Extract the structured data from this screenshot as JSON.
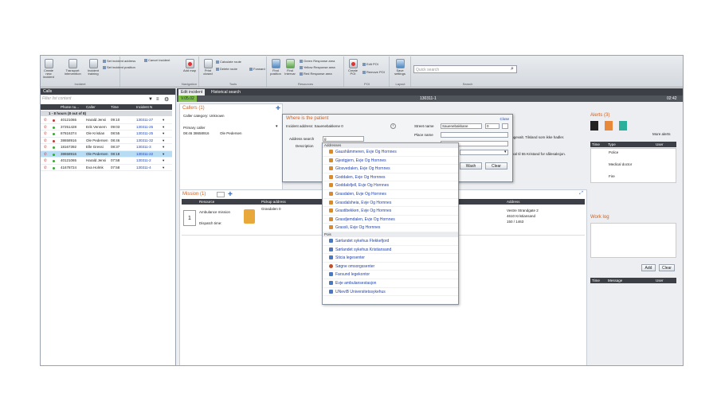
{
  "ribbon": {
    "groups": [
      {
        "label": "Incident",
        "buttons": [
          "Create new incident",
          "Transport intervention",
          "Incident training"
        ]
      },
      {
        "label": "Navigation",
        "buttons": [
          "Add map"
        ]
      },
      {
        "label": "Tools",
        "buttons": [
          "Print closed"
        ]
      },
      {
        "label": "Resources",
        "buttons": [
          "Find position",
          "Find Intervar"
        ]
      },
      {
        "label": "POI",
        "buttons": [
          "Create POI"
        ]
      },
      {
        "label": "Layout",
        "buttons": [
          "Save settings"
        ]
      },
      {
        "label": "Search",
        "buttons": []
      }
    ],
    "small": {
      "set_incident_address": "Set incident address",
      "cancel_incident": "Cancel incident",
      "set_incident_position": "Set incident position",
      "calculate_route": "Calculate route",
      "delete_route": "Delete route",
      "forward": "Forward",
      "green_response_area": "Green Response area",
      "yellow_response_area": "Yellow Response area",
      "red_response_area": "Red Response area",
      "edit_poi": "Edit POI",
      "remove_poi": "Remove POI"
    },
    "quick_search_placeholder": "Quick search"
  },
  "calls": {
    "title": "Calls",
    "filter_placeholder": "Filter list content",
    "columns": [
      "Phone nu...",
      "Caller",
      "Time",
      "Incident N"
    ],
    "group": "1 - 8 hours (8 out of 8)",
    "rows": [
      [
        "40121065",
        "Harald Jensi",
        "09:10",
        "130311-27"
      ],
      [
        "37251428",
        "Erik Vennern",
        "09:03",
        "130311-26"
      ],
      [
        "87816374",
        "Ole Kristian",
        "08:55",
        "130311-25"
      ],
      [
        "38658916",
        "Ole Pedersen",
        "08:46",
        "130311-32"
      ],
      [
        "18167392",
        "Elle Gressi",
        "08:37",
        "130311-3"
      ],
      [
        "38658916",
        "Ole Pedersen",
        "08:18",
        "130311-22"
      ],
      [
        "40121065",
        "Harald Jensi",
        "07:58",
        "130311-2"
      ],
      [
        "41678724",
        "Eva Holmk",
        "07:58",
        "130311-4"
      ]
    ]
  },
  "tabs": [
    "Edit incident",
    "Historical search"
  ],
  "incident_bar": {
    "version": "V.05.02",
    "incident_no": "130311-1",
    "time": "02:42"
  },
  "callers": {
    "title": "Callers (1)",
    "category": "Caller category: Unknown",
    "primary_caller": "Primary caller",
    "caller_time": "08:46 38658916",
    "caller_name": "Ole Pedersen"
  },
  "mission": {
    "title": "Mission (1)",
    "columns": [
      "Resource",
      "Pickup address",
      "Address"
    ],
    "row": {
      "index": "1",
      "resource": "Ambulance mission",
      "dispatch": "Dispatch time:",
      "pickup": "Grasdalen 0",
      "address1": "Vestre Strandgate 2",
      "address2": "4610 Kristiansand",
      "address3": "150 / 1463"
    },
    "extra": "Ingevalt. Tilsland som ikke hadler.",
    "extra2": "skal til 55 Kristand for sålesaksjon."
  },
  "dialog": {
    "title": "Where is the patient",
    "close": "Close",
    "incident_address": "Incident address: Sauenebakkene 0",
    "street_name_label": "Street name",
    "street_name_value": "Sauenebakkane",
    "street_number_value": "0",
    "place_name_label": "Place name",
    "address_search_label": "Address search",
    "address_search_value": "g",
    "description_label": "Description",
    "wash_label": "Wash",
    "clear_label": "Clear"
  },
  "dropdown": {
    "addresses_label": "Addresses",
    "addresses": [
      "Gaushåmmeren, Evje Og Hornnes",
      "Gjestgjern, Evje Og Hornnes",
      "Glosvedalen, Evje Og Hornnes",
      "Goddalen, Evje Og Hornnes",
      "Goddalsfjell, Evje Og Hornnes",
      "Grasdalen, Evje Og Hornnes",
      "Grasdalsheia, Evje Og Hornnes",
      "Grastibekken, Evje Og Hornnes",
      "Grasdjemdalen, Evje Og Hornnes",
      "Grassli, Evje Og Hornnes"
    ],
    "pois_label": "Pois",
    "pois": [
      "Sørlandet sykehus Flekkefjord",
      "Sørlandet sykehus Kristiansand",
      "Sticia legesenter",
      "Søgne omsorgssenter",
      "Farsund legekontor",
      "Evje ambulansestasjon",
      "UNeviB Universitetssykehus"
    ]
  },
  "alerts": {
    "title": "Alerts (3)",
    "more": "More alerts",
    "columns": [
      "Time",
      "Type",
      "User"
    ],
    "rows": [
      "Police",
      "Medical doctor",
      "Fire"
    ]
  },
  "worklog": {
    "title": "Work log",
    "add": "Add",
    "clear": "Clear",
    "columns": [
      "Time",
      "Message",
      "User"
    ]
  }
}
